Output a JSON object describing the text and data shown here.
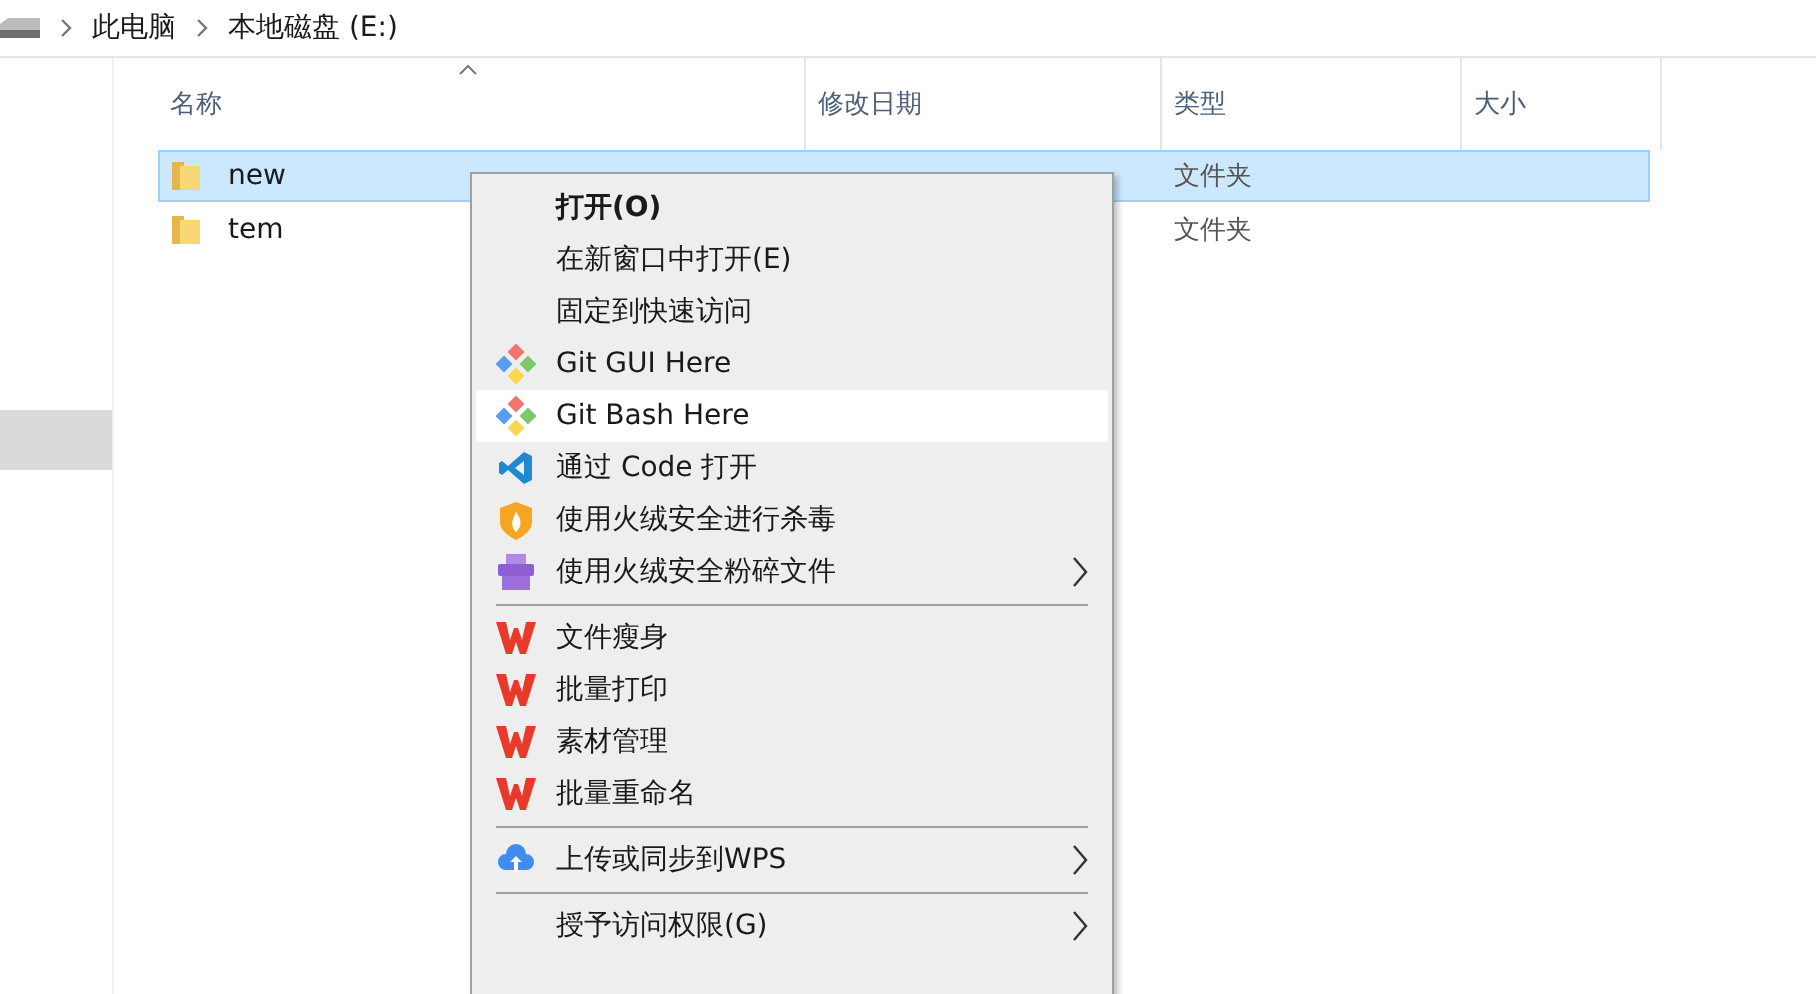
{
  "breadcrumb": [
    "此电脑",
    "本地磁盘 (E:)"
  ],
  "nav": {
    "items": [
      {
        "selected": false
      },
      {
        "selected": true
      }
    ]
  },
  "columns": [
    {
      "label": "名称",
      "sorted": true
    },
    {
      "label": "修改日期",
      "sorted": false
    },
    {
      "label": "类型",
      "sorted": false
    },
    {
      "label": "大小",
      "sorted": false
    }
  ],
  "rows": [
    {
      "name": "new",
      "type": "文件夹",
      "selected": true
    },
    {
      "name": "tem",
      "type": "文件夹",
      "selected": false
    }
  ],
  "menu": [
    {
      "kind": "plain",
      "label": "打开(O)",
      "bold": true,
      "submenu": false,
      "selected": false
    },
    {
      "kind": "plain",
      "label": "在新窗口中打开(E)",
      "bold": false,
      "submenu": false,
      "selected": false
    },
    {
      "kind": "plain",
      "label": "固定到快速访问",
      "bold": false,
      "submenu": false,
      "selected": false
    },
    {
      "kind": "git",
      "label": "Git GUI Here",
      "bold": false,
      "submenu": false,
      "selected": false
    },
    {
      "kind": "git",
      "label": "Git Bash Here",
      "bold": false,
      "submenu": false,
      "selected": true
    },
    {
      "kind": "code",
      "label": "通过 Code 打开",
      "bold": false,
      "submenu": false,
      "selected": false
    },
    {
      "kind": "shield",
      "label": "使用火绒安全进行杀毒",
      "bold": false,
      "submenu": false,
      "selected": false
    },
    {
      "kind": "shredder",
      "label": "使用火绒安全粉碎文件",
      "bold": false,
      "submenu": true,
      "selected": false
    },
    {
      "kind": "separator"
    },
    {
      "kind": "wps",
      "label": "文件瘦身",
      "bold": false,
      "submenu": false,
      "selected": false
    },
    {
      "kind": "wps",
      "label": "批量打印",
      "bold": false,
      "submenu": false,
      "selected": false
    },
    {
      "kind": "wps",
      "label": "素材管理",
      "bold": false,
      "submenu": false,
      "selected": false
    },
    {
      "kind": "wps",
      "label": "批量重命名",
      "bold": false,
      "submenu": false,
      "selected": false
    },
    {
      "kind": "separator"
    },
    {
      "kind": "cloud",
      "label": "上传或同步到WPS",
      "bold": false,
      "submenu": true,
      "selected": false
    },
    {
      "kind": "separator"
    },
    {
      "kind": "plain",
      "label": "授予访问权限(G)",
      "bold": false,
      "submenu": true,
      "selected": false
    }
  ]
}
